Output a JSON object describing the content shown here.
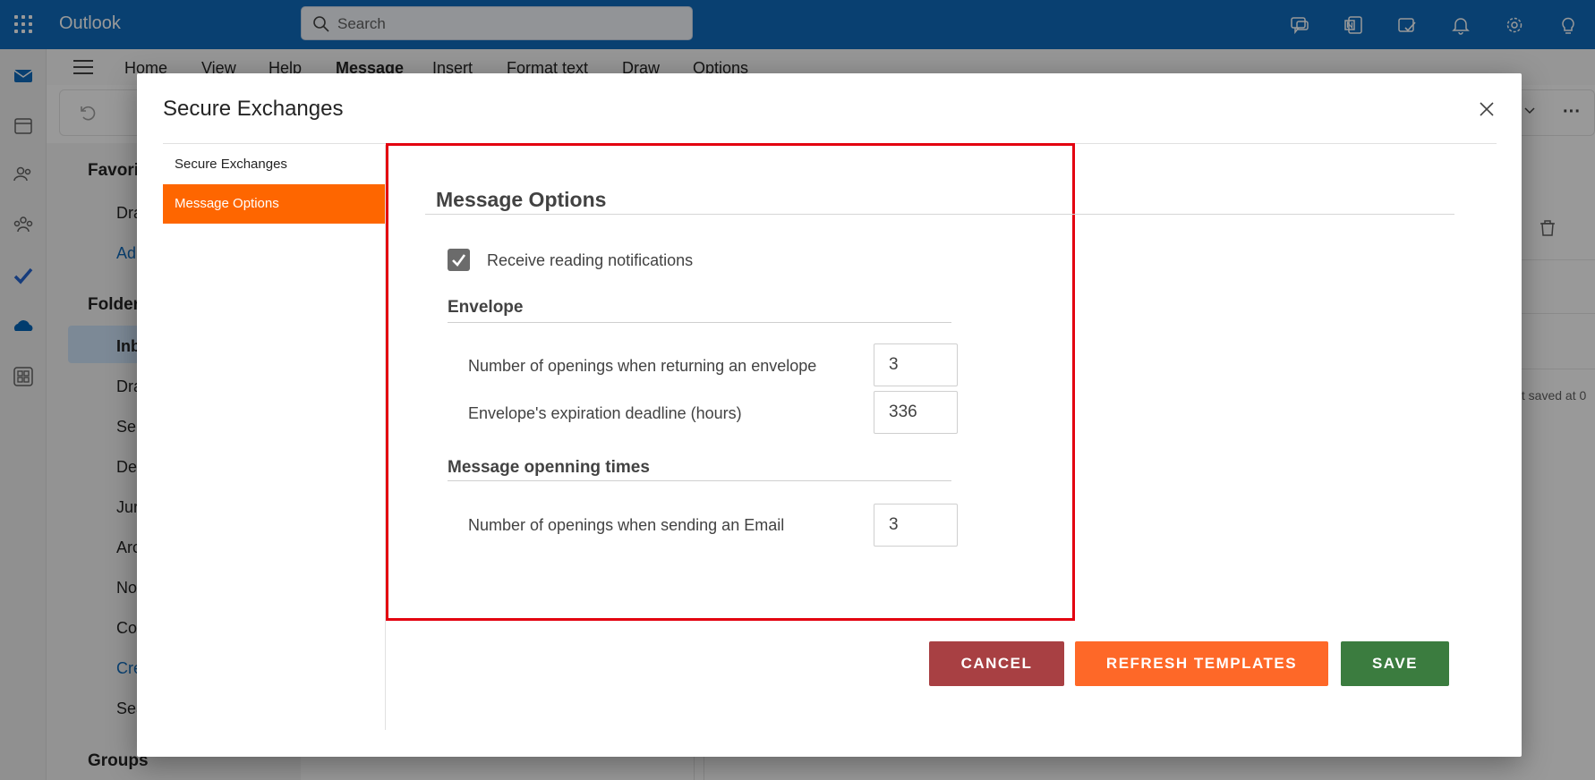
{
  "app": {
    "name": "Outlook"
  },
  "search": {
    "placeholder": "Search"
  },
  "topbar_icons": [
    "teams-chat-icon",
    "onenote-icon",
    "todo-icon",
    "bell-icon",
    "gear-icon",
    "lightbulb-icon"
  ],
  "ribbon": {
    "tabs": [
      "Home",
      "View",
      "Help",
      "Message",
      "Insert",
      "Format text",
      "Draw",
      "Options"
    ],
    "active_tab": "Message"
  },
  "nav": {
    "favorites": "Favori",
    "drafts_fav": "Dra",
    "add_fav": "Ad",
    "folders": "Folder",
    "inbox": "Inb",
    "drafts": "Dra",
    "sent": "Ser",
    "deleted": "De",
    "junk": "Jur",
    "archive": "Arc",
    "notes": "No",
    "conversation": "Co",
    "create": "Cre",
    "search_folders": "Sea",
    "groups": "Groups"
  },
  "reading_pane": {
    "draft_saved": "ft saved at 0"
  },
  "dialog": {
    "title": "Secure Exchanges",
    "menu": [
      {
        "label": "Secure Exchanges",
        "active": false
      },
      {
        "label": "Message Options",
        "active": true
      }
    ],
    "section_title": "Message Options",
    "reading_notifications": {
      "label": "Receive reading notifications",
      "checked": true
    },
    "envelope": {
      "title": "Envelope",
      "openings_label": "Number of openings when returning an envelope",
      "openings_value": "3",
      "expiration_label": "Envelope's expiration deadline (hours)",
      "expiration_value": "336"
    },
    "message_times": {
      "title": "Message openning times",
      "openings_label": "Number of openings when sending an Email",
      "openings_value": "3"
    },
    "buttons": {
      "cancel": "CANCEL",
      "refresh": "REFRESH TEMPLATES",
      "save": "SAVE"
    }
  },
  "colors": {
    "outlook_blue": "#0f6cbd",
    "active_menu": "#fe6600",
    "highlight_border": "#e3000f",
    "cancel": "#a84043",
    "refresh": "#fe6828",
    "save": "#3b7c3f"
  }
}
